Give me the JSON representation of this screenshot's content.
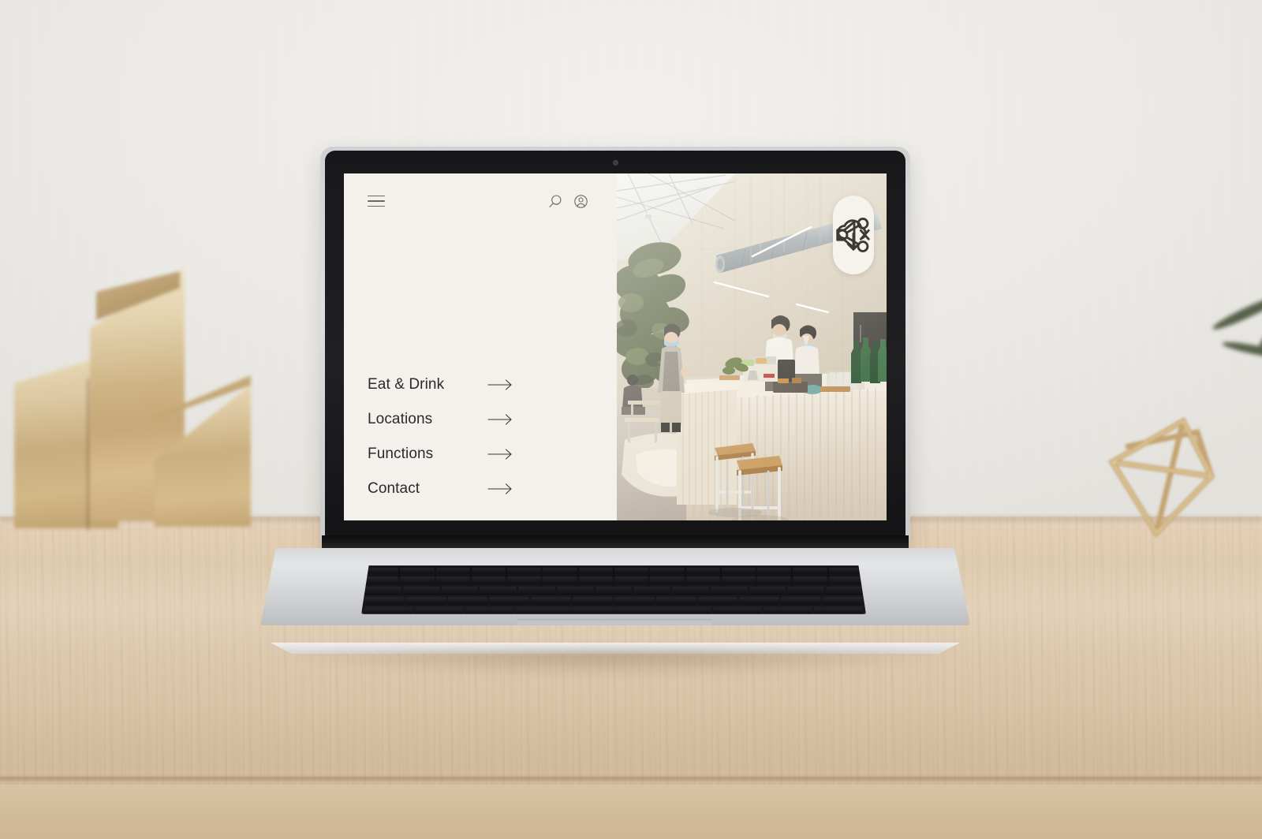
{
  "scene": {
    "description": "laptop-on-wooden-desk-mockup",
    "wall_color": "#eceae6",
    "desk_color": "#ddcbb0",
    "decor": [
      {
        "name": "gold-magazine-file-holders",
        "position": "left",
        "color": "#cdb282"
      },
      {
        "name": "gold-wireframe-octahedron",
        "position": "right",
        "color": "#c9ab78"
      },
      {
        "name": "green-plant-leaves",
        "position": "right-edge",
        "color": "#56614a"
      }
    ]
  },
  "device": {
    "name": "macbook-pro",
    "bezel_color": "#1b1b1d",
    "body_color": "#d5d7d8"
  },
  "website": {
    "panel_bg": "#f4f1ed",
    "text_color": "#2c2a28",
    "header": {
      "menu_icon": "hamburger-icon",
      "icons": [
        {
          "name": "search-icon",
          "label": "Search"
        },
        {
          "name": "account-icon",
          "label": "Account"
        }
      ]
    },
    "nav": {
      "items": [
        {
          "label": "Eat & Drink",
          "arrow": "arrow-right-icon"
        },
        {
          "label": "Locations",
          "arrow": "arrow-right-icon"
        },
        {
          "label": "Functions",
          "arrow": "arrow-right-icon"
        },
        {
          "label": "Contact",
          "arrow": "arrow-right-icon"
        }
      ]
    },
    "media": {
      "alt": "cafe-interior-staff-behind-fluted-counter",
      "pill_bg": "#f6f2ec",
      "controls": [
        {
          "name": "share-icon",
          "label": "Share"
        },
        {
          "name": "mute-icon",
          "label": "Mute",
          "state": "muted"
        },
        {
          "name": "cloud-download-icon",
          "label": "Download"
        }
      ]
    }
  }
}
